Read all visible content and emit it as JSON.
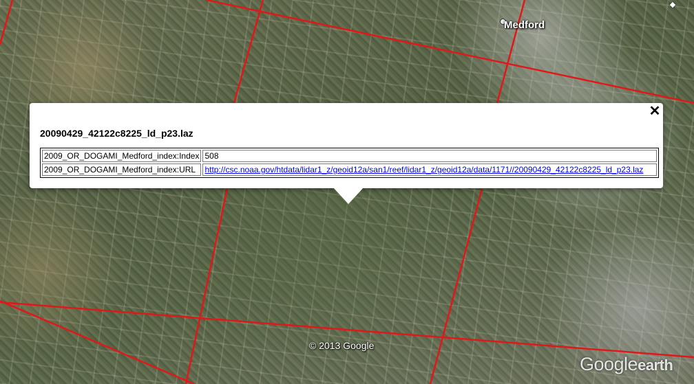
{
  "map": {
    "city_label": "Medford",
    "copyright": "© 2013 Google",
    "watermark_brand": "Google",
    "watermark_product": "earth",
    "grid_line_color": "#e01818"
  },
  "balloon": {
    "title": "20090429_42122c8225_ld_p23.laz",
    "close_symbol": "✕",
    "rows": [
      {
        "key": "2009_OR_DOGAMI_Medford_index:Index",
        "value": "508"
      },
      {
        "key": "2009_OR_DOGAMI_Medford_index:URL",
        "value": "http://csc.noaa.gov/htdata/lidar1_z/geoid12a/san1/reef/lidar1_z/geoid12a/data/1171//20090429_42122c8225_ld_p23.laz"
      }
    ]
  }
}
